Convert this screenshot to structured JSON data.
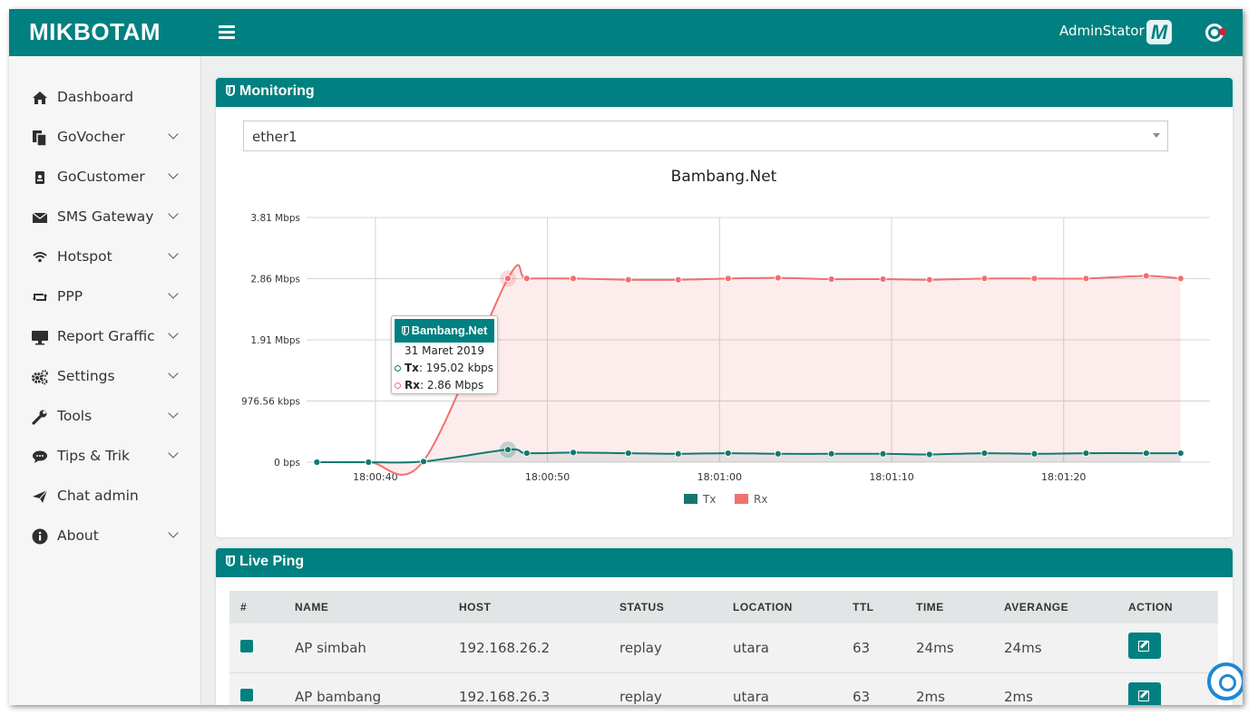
{
  "app": {
    "brand": "MIKBOTAM",
    "user_name": "AdminStator",
    "user_logo": "M"
  },
  "icons": {
    "menu": "hamburger-icon",
    "power": "power-icon"
  },
  "sidebar": {
    "items": [
      {
        "label": "Dashboard",
        "icon": "home-icon",
        "has_children": false
      },
      {
        "label": "GoVocher",
        "icon": "copy-icon",
        "has_children": true
      },
      {
        "label": "GoCustomer",
        "icon": "id-badge-icon",
        "has_children": true
      },
      {
        "label": "SMS Gateway",
        "icon": "envelope-icon",
        "has_children": true
      },
      {
        "label": "Hotspot",
        "icon": "wifi-icon",
        "has_children": true
      },
      {
        "label": "PPP",
        "icon": "retweet-icon",
        "has_children": true
      },
      {
        "label": "Report Graffic",
        "icon": "desktop-icon",
        "has_children": true
      },
      {
        "label": "Settings",
        "icon": "cogs-icon",
        "has_children": true
      },
      {
        "label": "Tools",
        "icon": "wrench-icon",
        "has_children": true
      },
      {
        "label": "Tips & Trik",
        "icon": "comments-icon",
        "has_children": true
      },
      {
        "label": "Chat admin",
        "icon": "paper-plane-icon",
        "has_children": false
      },
      {
        "label": "About",
        "icon": "info-circle-icon",
        "has_children": true
      }
    ]
  },
  "monitoring": {
    "title": "Monitoring",
    "interface_select": "ether1",
    "tooltip": {
      "title": "Bambang.Net",
      "date": "31 Maret 2019",
      "tx_label": "Tx",
      "tx_value": ": 195.02 kbps",
      "rx_label": "Rx",
      "rx_value": ": 2.86 Mbps"
    }
  },
  "chart_data": {
    "type": "area",
    "title": "Bambang.Net",
    "y_ticks": [
      "0 bps",
      "976.56 kbps",
      "1.91 Mbps",
      "2.86 Mbps",
      "3.81 Mbps"
    ],
    "ylim_mbps": [
      0,
      3.81
    ],
    "x_ticks": [
      "18:00:40",
      "18:00:50",
      "18:01:00",
      "18:01:10",
      "18:01:20"
    ],
    "x_tick_seconds": [
      40,
      50,
      60,
      70,
      80
    ],
    "x_seconds": [
      36.6,
      39.6,
      42.8,
      47.7,
      48.8,
      51.5,
      54.7,
      57.6,
      60.5,
      63.4,
      66.5,
      69.5,
      72.2,
      75.4,
      78.3,
      81.3,
      84.8,
      86.8
    ],
    "series": [
      {
        "name": "Tx",
        "color": "#13796f",
        "values_mbps": [
          0.0,
          0.0,
          0.01,
          0.195,
          0.14,
          0.15,
          0.14,
          0.13,
          0.14,
          0.13,
          0.13,
          0.13,
          0.12,
          0.14,
          0.13,
          0.14,
          0.14,
          0.14
        ]
      },
      {
        "name": "Rx",
        "color": "#f07070",
        "values_mbps": [
          0.0,
          0.0,
          0.02,
          2.86,
          2.86,
          2.86,
          2.84,
          2.84,
          2.86,
          2.87,
          2.85,
          2.85,
          2.84,
          2.86,
          2.86,
          2.86,
          2.9,
          2.86
        ]
      }
    ],
    "grid": true,
    "legend_position": "bottom"
  },
  "live_ping": {
    "title": "Live Ping",
    "columns": [
      "#",
      "NAME",
      "HOST",
      "STATUS",
      "LOCATION",
      "TTL",
      "TIME",
      "AVERANGE",
      "ACTION"
    ],
    "rows": [
      {
        "name": "AP simbah",
        "host": "192.168.26.2",
        "status": "replay",
        "location": "utara",
        "ttl": "63",
        "time": "24ms",
        "average": "24ms"
      },
      {
        "name": "AP bambang",
        "host": "192.168.26.3",
        "status": "replay",
        "location": "utara",
        "ttl": "63",
        "time": "2ms",
        "average": "2ms"
      }
    ]
  }
}
